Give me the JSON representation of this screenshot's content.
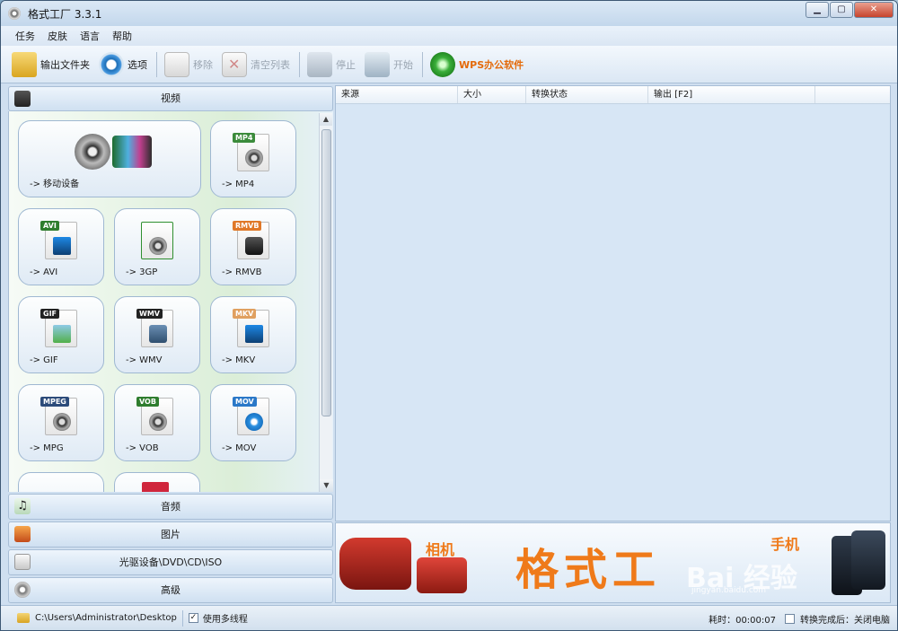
{
  "window": {
    "title": "格式工厂 3.3.1"
  },
  "menu": [
    "任务",
    "皮肤",
    "语言",
    "帮助"
  ],
  "toolbar": {
    "output_folder": "输出文件夹",
    "options": "选项",
    "remove": "移除",
    "clear_list": "清空列表",
    "stop": "停止",
    "start": "开始",
    "wps": "WPS办公软件"
  },
  "categories": {
    "video": "视频",
    "audio": "音频",
    "image": "图片",
    "rom": "光驱设备\\DVD\\CD\\ISO",
    "advanced": "高级"
  },
  "tiles": [
    {
      "label": "-> 移动设备",
      "badge": "",
      "color": "#3a6ea5"
    },
    {
      "label": "-> MP4",
      "badge": "MP4",
      "color": "#3b8b3b"
    },
    {
      "label": "-> AVI",
      "badge": "AVI",
      "color": "#2e7d2e"
    },
    {
      "label": "-> 3GP",
      "badge": "",
      "color": "#2f8f2f"
    },
    {
      "label": "-> RMVB",
      "badge": "RMVB",
      "color": "#e07828"
    },
    {
      "label": "-> GIF",
      "badge": "GIF",
      "color": "#222222"
    },
    {
      "label": "-> WMV",
      "badge": "WMV",
      "color": "#222222"
    },
    {
      "label": "-> MKV",
      "badge": "MKV",
      "color": "#e0a060"
    },
    {
      "label": "-> MPG",
      "badge": "MPEG",
      "color": "#2c4b7a"
    },
    {
      "label": "-> VOB",
      "badge": "VOB",
      "color": "#2e7d2e"
    },
    {
      "label": "-> MOV",
      "badge": "MOV",
      "color": "#2a78c8"
    }
  ],
  "table_headers": [
    "来源",
    "大小",
    "转换状态",
    "输出 [F2]"
  ],
  "banner": {
    "title": "格式工",
    "camera_label": "相机",
    "phone_label": "手机",
    "watermark": "Bai 经验",
    "watermark_url": "jingyan.baidu.com"
  },
  "status": {
    "path": "C:\\Users\\Administrator\\Desktop",
    "multithread": "使用多线程",
    "elapsed": "耗时：00:00:07",
    "after_convert": "转换完成后：关闭电脑"
  }
}
